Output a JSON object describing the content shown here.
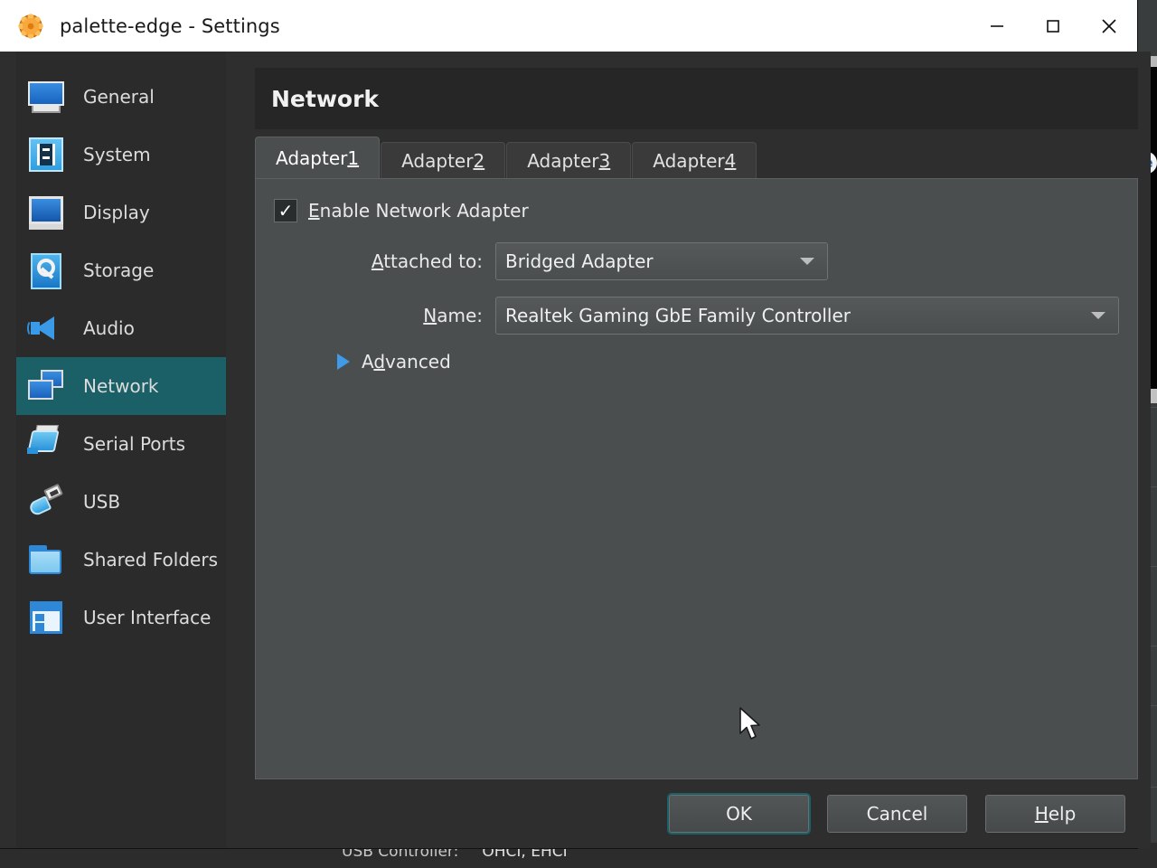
{
  "window": {
    "title": "palette-edge - Settings",
    "app_icon": "virtualbox-icon",
    "controls": {
      "minimize": "—",
      "maximize": "□",
      "close": "✕"
    }
  },
  "sidebar": {
    "items": [
      {
        "label": "General",
        "icon": "monitor-icon",
        "selected": false
      },
      {
        "label": "System",
        "icon": "chip-icon",
        "selected": false
      },
      {
        "label": "Display",
        "icon": "display-icon",
        "selected": false
      },
      {
        "label": "Storage",
        "icon": "harddisk-icon",
        "selected": false
      },
      {
        "label": "Audio",
        "icon": "speaker-icon",
        "selected": false
      },
      {
        "label": "Network",
        "icon": "network-icon",
        "selected": true
      },
      {
        "label": "Serial Ports",
        "icon": "serial-port-icon",
        "selected": false
      },
      {
        "label": "USB",
        "icon": "usb-icon",
        "selected": false
      },
      {
        "label": "Shared Folders",
        "icon": "folder-icon",
        "selected": false
      },
      {
        "label": "User Interface",
        "icon": "user-interface-icon",
        "selected": false
      }
    ]
  },
  "page": {
    "title": "Network",
    "tabs": [
      {
        "label": "Adapter ",
        "mnemonic": "1",
        "active": true
      },
      {
        "label": "Adapter ",
        "mnemonic": "2",
        "active": false
      },
      {
        "label": "Adapter ",
        "mnemonic": "3",
        "active": false
      },
      {
        "label": "Adapter ",
        "mnemonic": "4",
        "active": false
      }
    ],
    "enable_adapter": {
      "checked": true,
      "check_glyph": "✓",
      "label_pre": "",
      "label_mnemonic": "E",
      "label_post": "nable Network Adapter"
    },
    "attached_to": {
      "label_mnemonic": "A",
      "label_post": "ttached to:",
      "value": "Bridged Adapter",
      "arrow": "chevron-down-icon"
    },
    "name_field": {
      "label_mnemonic": "N",
      "label_post": "ame:",
      "value": "Realtek Gaming GbE Family Controller",
      "arrow": "chevron-down-icon"
    },
    "advanced": {
      "expanded": false,
      "triangle": "triangle-right-icon",
      "label_pre": "A",
      "label_mnemonic": "d",
      "label_post": "vanced"
    }
  },
  "footer": {
    "ok": "OK",
    "cancel": "Cancel",
    "help_mnemonic": "H",
    "help_post": "elp"
  },
  "background": {
    "usb_controller_label": "USB Controller:",
    "usb_controller_value": "OHCI, EHCI"
  },
  "colors": {
    "window_bg": "#2e2e2e",
    "sidebar_bg": "#2b2b2b",
    "selection": "#1a6066",
    "panel_bg": "#4b4e4e",
    "titlebar_bg": "#ffffff",
    "accent_blue": "#3f9be8",
    "icon_orange": "#f0902a"
  }
}
